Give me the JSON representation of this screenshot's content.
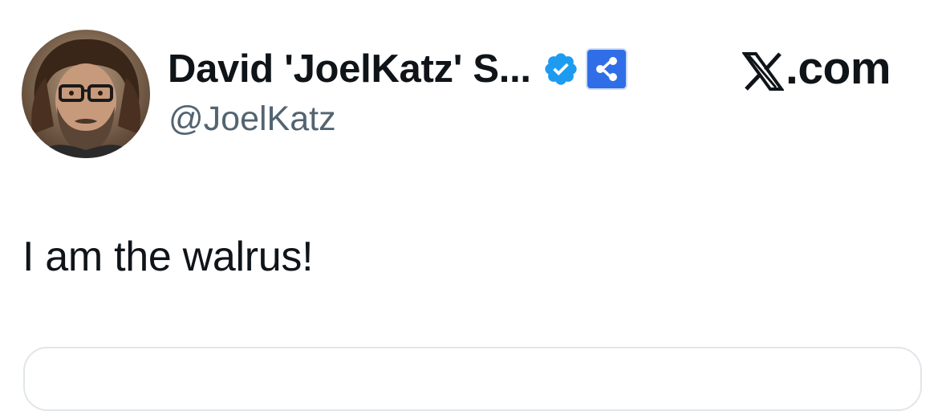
{
  "tweet": {
    "author": {
      "display_name": "David 'JoelKatz' S...",
      "handle": "@JoelKatz",
      "avatar_icon": "user-avatar-photo",
      "verified_icon": "verified-badge-icon",
      "affiliate_icon": "ripple-affiliate-badge-icon"
    },
    "brand": {
      "text": ".com",
      "icon": "x-logo-icon"
    },
    "text": "I am the walrus!"
  },
  "colors": {
    "verified": "#1d9bf0",
    "affiliate": "#2f6ee6",
    "handle": "#536471",
    "text": "#0f1419",
    "card_border": "#e1e6ea"
  }
}
